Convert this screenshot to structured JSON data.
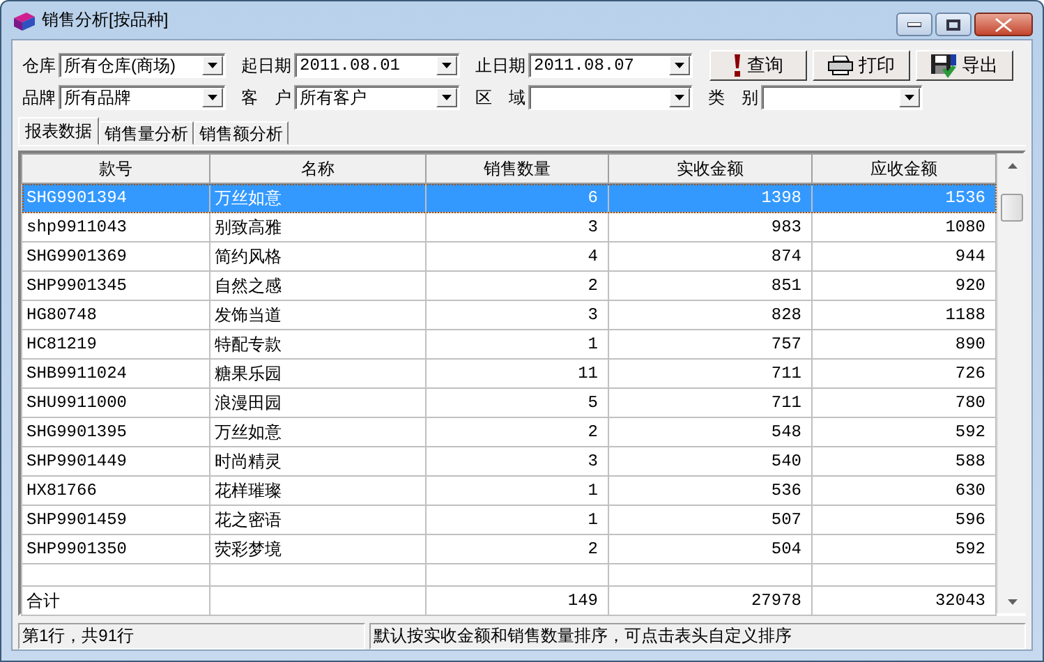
{
  "window": {
    "title": "销售分析[按品种]"
  },
  "filters": [
    {
      "label": "仓库",
      "value": "所有仓库(商场)",
      "kind": "combo"
    },
    {
      "label": "起日期",
      "value": "2011.08.01",
      "kind": "combo"
    },
    {
      "label": "止日期",
      "value": "2011.08.07",
      "kind": "combo"
    },
    {
      "label": "品牌",
      "value": "所有品牌",
      "kind": "combo"
    },
    {
      "label": "客　户",
      "value": "所有客户",
      "kind": "combo"
    },
    {
      "label": "区　域",
      "kind": "combo"
    },
    {
      "label": "类　别",
      "kind": "combo"
    }
  ],
  "buttons": [
    {
      "label": "查询",
      "kind": "query"
    },
    {
      "label": "打印",
      "kind": "print"
    },
    {
      "label": "导出",
      "kind": "export"
    }
  ],
  "tabs": [
    {
      "label": "报表数据",
      "selected": true
    },
    {
      "label": "销售量分析",
      "selected": false
    },
    {
      "label": "销售额分析",
      "selected": false
    }
  ],
  "table": {
    "columns": [
      "款号",
      "名称",
      "销售数量",
      "实收金额",
      "应收金额"
    ],
    "rows": [
      {
        "cells": [
          "SHG9901394",
          "万丝如意",
          "6",
          "1398",
          "1536"
        ],
        "selected": true
      },
      {
        "cells": [
          "shp9911043",
          "别致高雅",
          "3",
          "983",
          "1080"
        ],
        "selected": false
      },
      {
        "cells": [
          "SHG9901369",
          "简约风格",
          "4",
          "874",
          "944"
        ],
        "selected": false
      },
      {
        "cells": [
          "SHP9901345",
          "自然之感",
          "2",
          "851",
          "920"
        ],
        "selected": false
      },
      {
        "cells": [
          "HG80748",
          "发饰当道",
          "3",
          "828",
          "1188"
        ],
        "selected": false
      },
      {
        "cells": [
          "HC81219",
          "特配专款",
          "1",
          "757",
          "890"
        ],
        "selected": false
      },
      {
        "cells": [
          "SHB9911024",
          "糖果乐园",
          "11",
          "711",
          "726"
        ],
        "selected": false
      },
      {
        "cells": [
          "SHU9911000",
          "浪漫田园",
          "5",
          "711",
          "780"
        ],
        "selected": false
      },
      {
        "cells": [
          "SHG9901395",
          "万丝如意",
          "2",
          "548",
          "592"
        ],
        "selected": false
      },
      {
        "cells": [
          "SHP9901449",
          "时尚精灵",
          "3",
          "540",
          "588"
        ],
        "selected": false
      },
      {
        "cells": [
          "HX81766",
          "花样璀璨",
          "1",
          "536",
          "630"
        ],
        "selected": false
      },
      {
        "cells": [
          "SHP9901459",
          "花之密语",
          "1",
          "507",
          "596"
        ],
        "selected": false
      },
      {
        "cells": [
          "SHP9901350",
          "荧彩梦境",
          "2",
          "504",
          "592"
        ],
        "selected": false
      }
    ],
    "total": {
      "label": "合计",
      "values": [
        "149",
        "27978",
        "32043"
      ]
    }
  },
  "status_bar": [
    "第1行，共91行",
    "默认按实收金额和销售数量排序，可点击表头自定义排序"
  ]
}
